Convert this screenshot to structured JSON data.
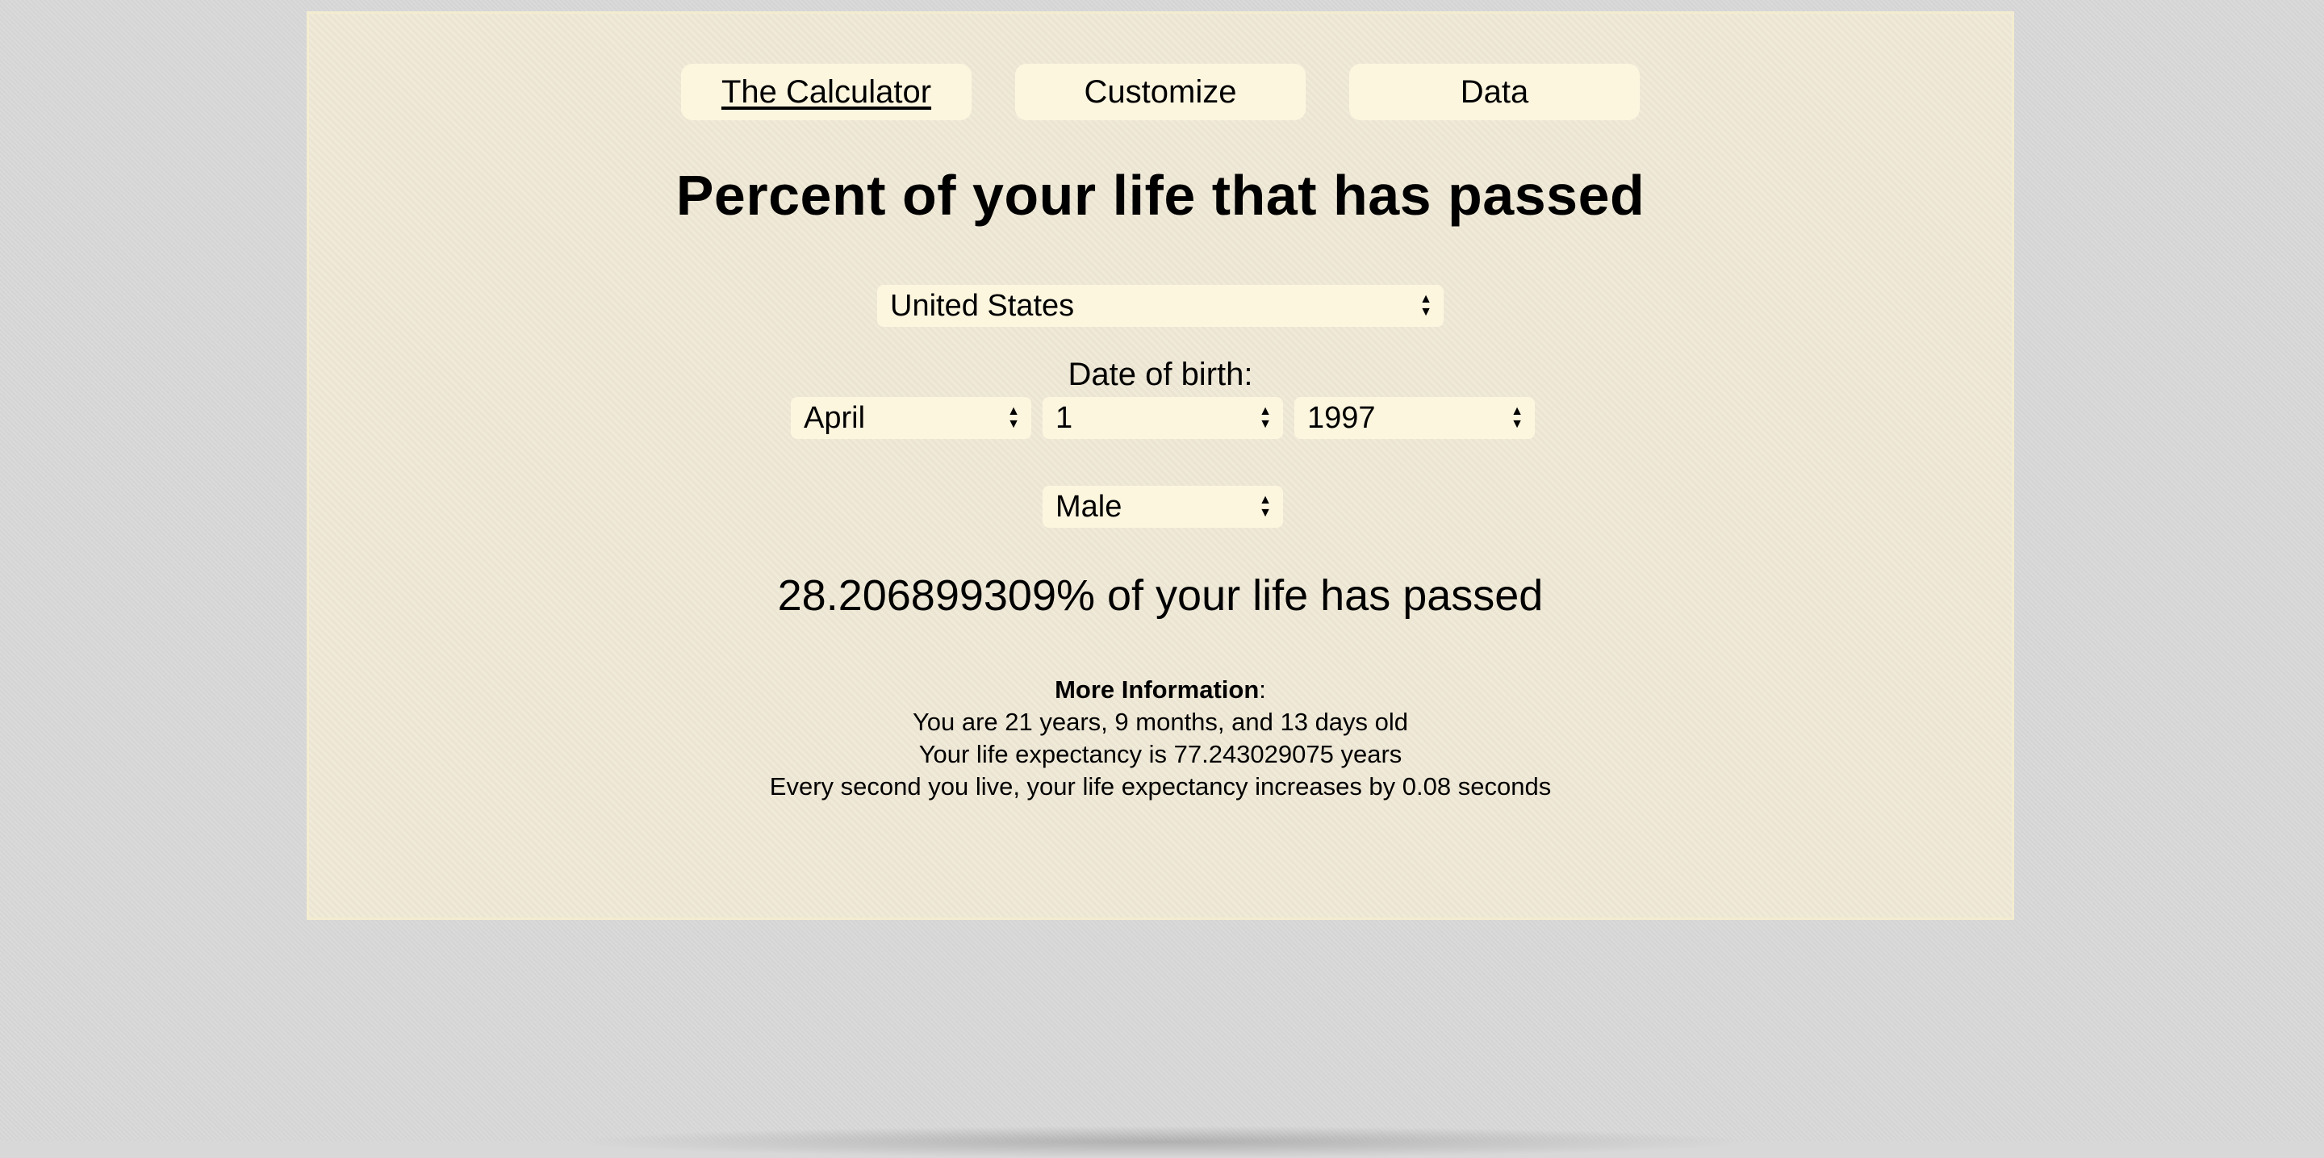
{
  "tabs": [
    {
      "label": "The Calculator",
      "active": true
    },
    {
      "label": "Customize",
      "active": false
    },
    {
      "label": "Data",
      "active": false
    }
  ],
  "title": "Percent of your life that has passed",
  "country": {
    "selected": "United States"
  },
  "dob": {
    "label": "Date of birth:",
    "month": "April",
    "day": "1",
    "year": "1997"
  },
  "sex": {
    "selected": "Male"
  },
  "result": "28.206899309% of your life has passed",
  "more_info": {
    "heading": "More Information",
    "heading_suffix": ":",
    "age_line": "You are 21 years, 9 months, and 13 days old",
    "expectancy_line": "Your life expectancy is 77.243029075 years",
    "increase_line": "Every second you live, your life expectancy increases by 0.08 seconds"
  },
  "colors": {
    "page_background": "#d8d8d8",
    "panel_background": "#efe8d5",
    "control_background": "#fdf6df"
  }
}
